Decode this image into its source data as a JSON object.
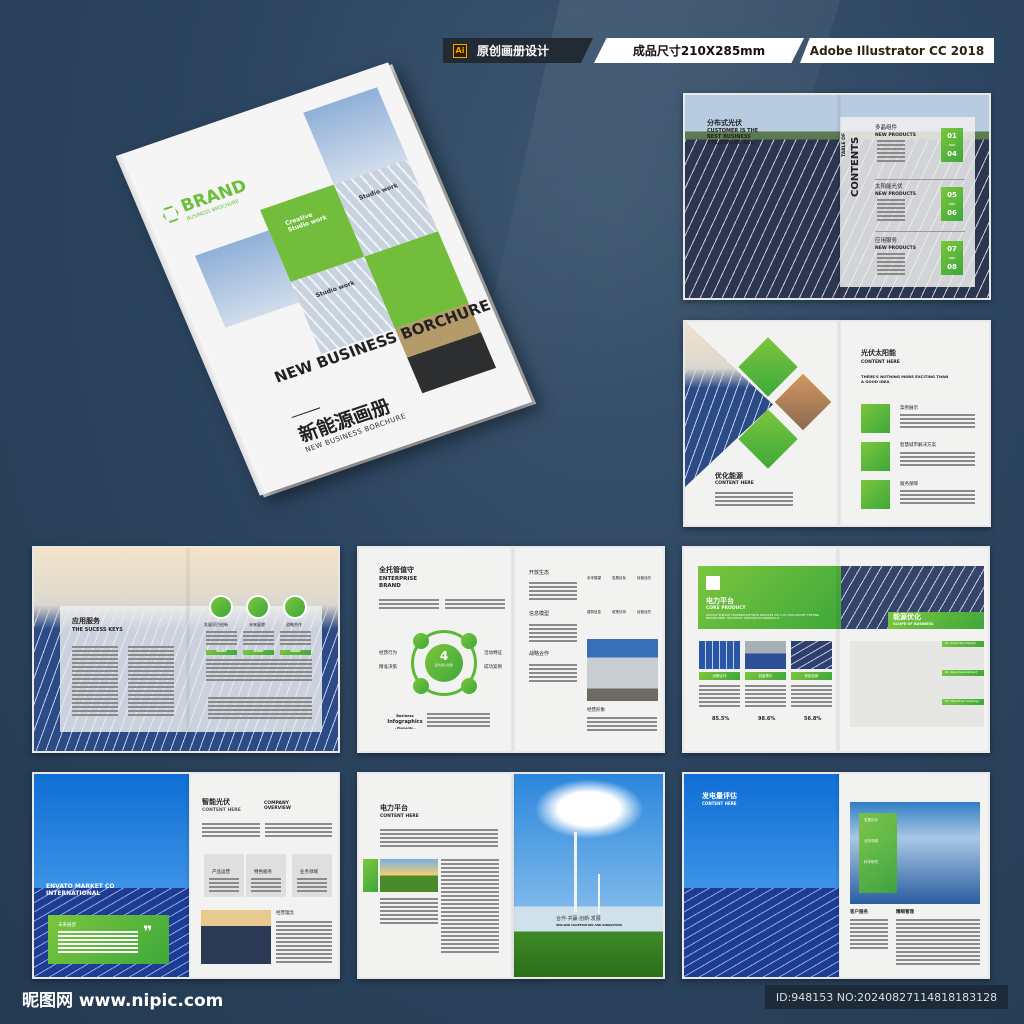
{
  "header": {
    "software": "原创画册设计",
    "software_icon": "Ai",
    "size": "成品尺寸210X285mm",
    "app": "Adobe Illustrator CC 2018"
  },
  "cover": {
    "brand": "BRAND",
    "brand_sub": "BUSINESS BROCHURE",
    "tile1": "Creative Studio work",
    "tile2": "Studio work",
    "tile3": "Studio work",
    "title": "NEW BUSINESS BORCHURE",
    "cn_title": "新能源画册",
    "en_sub": "NEW BUSINESS BORCHURE"
  },
  "toc": {
    "title": "分布式光伏",
    "subtitle": "CUSTOMER IS THE BEST BUSINESS STRATEG OF ALL",
    "table_of": "TABLE OF",
    "contents": "CONTENTS",
    "sections": [
      {
        "cn": "多晶组件",
        "en": "NEW PRODUCTS",
        "from": "01",
        "to": "04"
      },
      {
        "cn": "太阳能光伏",
        "en": "NEW PRODUCTS",
        "from": "05",
        "to": "06"
      },
      {
        "cn": "应用服务",
        "en": "NEW PRODUCTS",
        "from": "07",
        "to": "08"
      }
    ]
  },
  "spread2": {
    "left_cn": "优化能源",
    "left_en": "CONTENT HERE",
    "right_cn": "光伏太阳能",
    "right_en": "CONTENT HERE",
    "tagline": "THERE'S NOTHING MORE EXCITING THAN A GOOD IDEA",
    "items": [
      "案例展示",
      "智慧城市解决方案",
      "服务保障"
    ]
  },
  "spread3": {
    "cn": "应用服务",
    "en": "THE SUCESS KEYS",
    "circles": [
      "发展项目创新",
      "未来展望",
      "战略合作"
    ],
    "more": "MORE"
  },
  "spread4": {
    "cn": "全托管值守",
    "en": "ENTERPRISE BRAND",
    "center_num": "4",
    "center_label": "四大核心优势",
    "left_labels": [
      "经营行为",
      "精准决策"
    ],
    "right_labels": [
      "活动特征",
      "成功案例"
    ],
    "infographics": [
      "Business",
      "Infographics",
      "- Elements -"
    ],
    "headings": [
      "开放生态",
      "信息模型",
      "战略合作"
    ],
    "grid": [
      "未来展望",
      "发展目标",
      "经营目的",
      "建筑信息",
      "政策扶持",
      "经营目的"
    ],
    "photo_caption": "经营形象"
  },
  "spread5": {
    "cn": "电力平台",
    "en": "CORE PRODUCT",
    "desc": "QUICKLY PURSUE COOPERATIVE META SERVICES VIS A VIS HIGH-PAYOFF TESTING PROCEDURES. HOLISTICLY UNLEASH ECONOMICALLY",
    "banner_cn": "能源优化",
    "banner_en": "SCOPE OF BUSINESS",
    "cards": [
      {
        "label": "战略合作",
        "pct": "85.5%"
      },
      {
        "label": "前景提示",
        "pct": "98.6%"
      },
      {
        "label": "积极创新",
        "pct": "56.8%"
      }
    ],
    "bars": [
      "01. Corporate Identity",
      "02. Apps Development",
      "03. Marketing Campaign"
    ]
  },
  "spread6": {
    "envato": "ENVATO MARKET CO INTERNATIONAL",
    "quote_title": "未来展望",
    "cn": "智能光伏",
    "en": "CONTENT HERE",
    "overview": "COMPANY OVERVIEW",
    "boxes": [
      "产品运营",
      "特色服务",
      "业务领域"
    ],
    "philosophy": "经营理念"
  },
  "spread7": {
    "cn": "电力平台",
    "en": "CONTENT HERE",
    "slogan": "合作·共赢·创新·发展",
    "slogan_en": "WIN-WIN COOPERATION AND INNOVATION"
  },
  "spread8": {
    "cn": "发电量评估",
    "en": "CONTENT HERE",
    "callouts": [
      "发展目标",
      "业务领域",
      "科学研究"
    ],
    "cols": [
      "客户服务",
      "精细管理"
    ]
  },
  "footer": {
    "logo": "昵图网 www.nipic.com",
    "id": "ID:948153 NO:20240827114818183128"
  },
  "colors": {
    "green": "#72bd3b",
    "background": "#2a415a"
  }
}
